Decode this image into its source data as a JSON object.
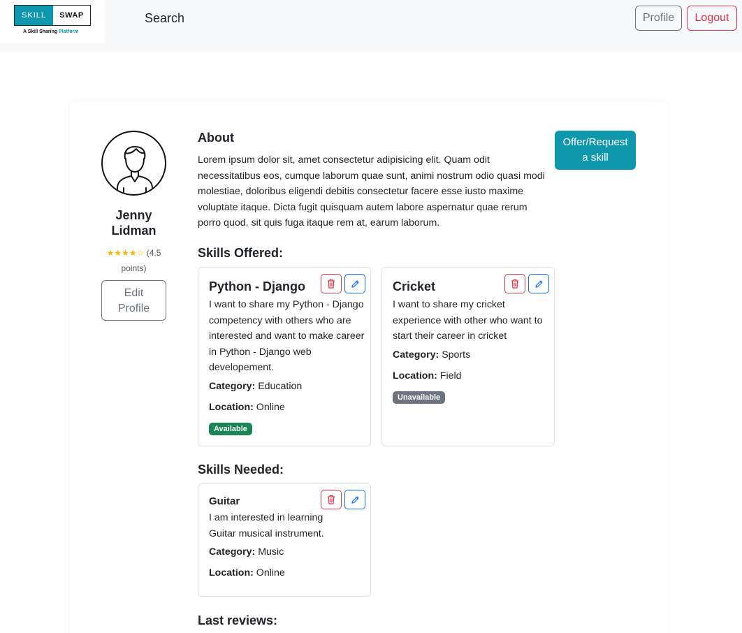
{
  "navbar": {
    "logo": {
      "left": "SKILL",
      "right": "SWAP",
      "tag_prefix": "A Skill Sharing",
      "tag_accent": "Platform"
    },
    "search_label": "Search",
    "profile_label": "Profile",
    "logout_label": "Logout"
  },
  "user": {
    "name_first": "Jenny",
    "name_last": "Lidman",
    "stars": "★★★★☆",
    "rating_value": "(4.5",
    "rating_unit": "points)",
    "edit_line1": "Edit",
    "edit_line2": "Profile"
  },
  "about": {
    "title": "About",
    "text": "Lorem ipsum dolor sit, amet consectetur adipisicing elit. Quam odit necessitatibus eos, cumque laborum quae sunt, animi nostrum odio quasi modi molestiae, doloribus eligendi debitis consectetur facere esse iusto maxime voluptate itaque. Dicta fugit quisquam autem labore aspernatur quae rerum porro quod, sit quis fuga itaque rem at, earum laborum."
  },
  "offer_button": {
    "line1": "Offer/Request",
    "line2": "a skill"
  },
  "skills_offered": {
    "title": "Skills Offered:",
    "items": [
      {
        "name": "Python - Django",
        "description": "I want to share my Python - Django competency with others who are interested and want to make career in Python - Django web developement.",
        "category_label": "Category:",
        "category": "Education",
        "location_label": "Location:",
        "location": "Online",
        "status": "Available",
        "status_color": "#198754"
      },
      {
        "name": "Cricket",
        "description": "I want to share my cricket experience with other who want to start their career in cricket",
        "category_label": "Category:",
        "category": "Sports",
        "location_label": "Location:",
        "location": "Field",
        "status": "Unavailable",
        "status_color": "#6c757d"
      }
    ]
  },
  "skills_needed": {
    "title": "Skills Needed:",
    "items": [
      {
        "name": "Guitar",
        "description": "I am interested in learning Guitar musical instrument.",
        "category_label": "Category:",
        "category": "Music",
        "location_label": "Location:",
        "location": "Online"
      }
    ]
  },
  "reviews": {
    "title": "Last reviews:"
  },
  "icons": {
    "delete": "trash-icon",
    "edit": "pencil-icon",
    "avatar": "user-avatar-icon"
  },
  "colors": {
    "primary": "#0f97ad",
    "danger": "#dc3545",
    "edit_blue": "#0d6efd",
    "success": "#198754",
    "secondary": "#6c757d",
    "star": "#f5b800"
  }
}
